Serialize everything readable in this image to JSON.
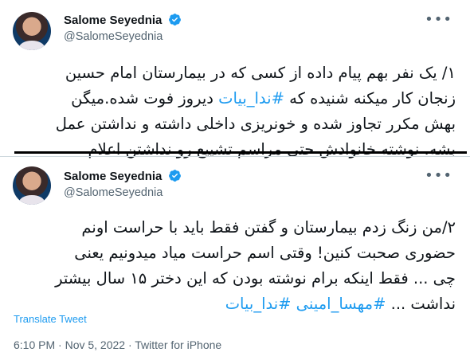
{
  "tweet1": {
    "author_name": "Salome Seyednia",
    "author_handle": "@SalomeSeyednia",
    "lines": [
      {
        "pre": "١/ یک نفر بهم پیام داده از کسی که در بیمارستان امام حسین",
        "tag": "",
        "post": ""
      },
      {
        "pre": "زنجان کار میکنه شنیده که ",
        "tag": "#ندا_بیات",
        "post": " دیروز فوت شده.میگن"
      },
      {
        "pre": "بهش مکرر تجاوز شده و خونریزی داخلی داشته و نداشتن عمل",
        "tag": "",
        "post": ""
      },
      {
        "pre": "بشه. نوشته خانوادش حتی مراسم تشییع رو نداشتن اعلام",
        "tag": "",
        "post": ""
      }
    ]
  },
  "tweet2": {
    "author_name": "Salome Seyednia",
    "author_handle": "@SalomeSeyednia",
    "lines": [
      {
        "pre": "٢/من زنگ زدم بیمارستان و گفتن فقط باید با حراست اونم",
        "tag": "",
        "post": ""
      },
      {
        "pre": "حضوری صحبت کنین! وقتی اسم حراست میاد میدونیم یعنی",
        "tag": "",
        "post": ""
      },
      {
        "pre": "چی ... فقط اینکه برام نوشته بودن که این دختر ۱۵ سال بیشتر",
        "tag": "",
        "post": ""
      },
      {
        "pre": "نداشت ... ",
        "tag": "#مهسا_امینی #ندا_بیات",
        "post": ""
      }
    ],
    "translate_label": "Translate Tweet",
    "timestamp": "6:10 PM · Nov 5, 2022 · Twitter for iPhone"
  },
  "icons": {
    "more": "more-options-icon",
    "verified": "verified-badge-icon"
  },
  "colors": {
    "accent": "#1d9bf0",
    "secondary_text": "#536471",
    "primary_text": "#0f1419"
  }
}
